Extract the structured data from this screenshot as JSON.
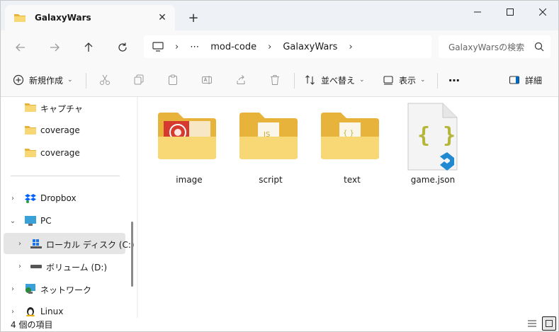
{
  "window": {
    "tab_title": "GalaxyWars",
    "tab_close": "✕",
    "new_tab": "+"
  },
  "address": {
    "more": "⋯",
    "crumbs": [
      "mod-code",
      "GalaxyWars"
    ],
    "separator": "›"
  },
  "search": {
    "placeholder": "GalaxyWarsの検索"
  },
  "toolbar": {
    "new_label": "新規作成",
    "sort_label": "並べ替え",
    "view_label": "表示",
    "more_label": "⋯",
    "details_label": "詳細"
  },
  "nav": {
    "items": [
      {
        "label": "キャプチャ"
      },
      {
        "label": "coverage"
      },
      {
        "label": "coverage"
      },
      {
        "label": "Dropbox"
      },
      {
        "label": "PC"
      },
      {
        "label": "ローカル ディスク (C:)"
      },
      {
        "label": "ボリューム (D:)"
      },
      {
        "label": "ネットワーク"
      },
      {
        "label": "Linux"
      }
    ]
  },
  "files": [
    {
      "name": "image",
      "kind": "folder-image"
    },
    {
      "name": "script",
      "kind": "folder-script"
    },
    {
      "name": "text",
      "kind": "folder-text"
    },
    {
      "name": "game.json",
      "kind": "json-file"
    }
  ],
  "status": {
    "count_text": "4 個の項目"
  },
  "colors": {
    "folder_back": "#e8b33a",
    "folder_front": "#f8d775",
    "accent": "#0067c0",
    "json_brace": "#b5b53a",
    "vscode_blue": "#1f8ad2"
  }
}
